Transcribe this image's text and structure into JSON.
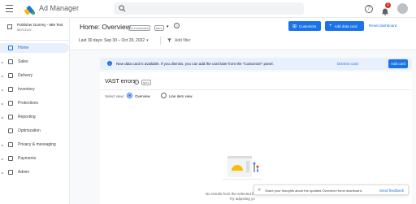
{
  "app": {
    "name": "Ad Manager"
  },
  "topbar": {
    "help_glyph": "?",
    "notifications_count": "1"
  },
  "network": {
    "name": "Publisher Dummy - MM Test",
    "id": "56713137"
  },
  "sidebar": {
    "items": [
      {
        "label": "Home",
        "icon": "home-icon",
        "active": true
      },
      {
        "label": "Sales",
        "icon": "sales-icon"
      },
      {
        "label": "Delivery",
        "icon": "delivery-icon"
      },
      {
        "label": "Inventory",
        "icon": "inventory-icon"
      },
      {
        "label": "Protections",
        "icon": "protections-icon"
      },
      {
        "label": "Reporting",
        "icon": "reporting-icon"
      },
      {
        "label": "Optimization",
        "icon": "optimization-icon"
      },
      {
        "label": "Privacy & messaging",
        "icon": "privacy-icon"
      },
      {
        "label": "Payments",
        "icon": "payments-icon"
      },
      {
        "label": "Admin",
        "icon": "admin-icon"
      }
    ]
  },
  "header": {
    "title": "Home: Overview",
    "customizable_badge": "CUSTOMIZABLE",
    "beta_badge": "BETA",
    "date_range": "Last 30 days: Sep 30 – Oct 29, 2022",
    "add_filter": "Add filter",
    "customize_label": "Customize",
    "add_data_card_label": "Add data card",
    "reset_label": "Reset dashboard"
  },
  "banner": {
    "message": "New data card is available. If you dismiss, you can add the card later from the \"Customize\" panel.",
    "dismiss_label": "Dismiss card",
    "add_label": "Add card"
  },
  "card": {
    "title": "VAST errors",
    "beta_badge": "BETA",
    "view_label": "Select view:",
    "options": [
      "Overview",
      "Line item view"
    ],
    "selected": "Overview",
    "empty_line1": "No results from the selected filters and dates.",
    "empty_line2": "Try adjusting yo"
  },
  "snackbar": {
    "text": "Share your thoughts about the updated Overview Home dashboard.",
    "action": "Send feedback"
  },
  "colors": {
    "accent": "#1a73e8",
    "banner_bg": "#e8f0fe",
    "page_bg": "#f8f9fa"
  }
}
